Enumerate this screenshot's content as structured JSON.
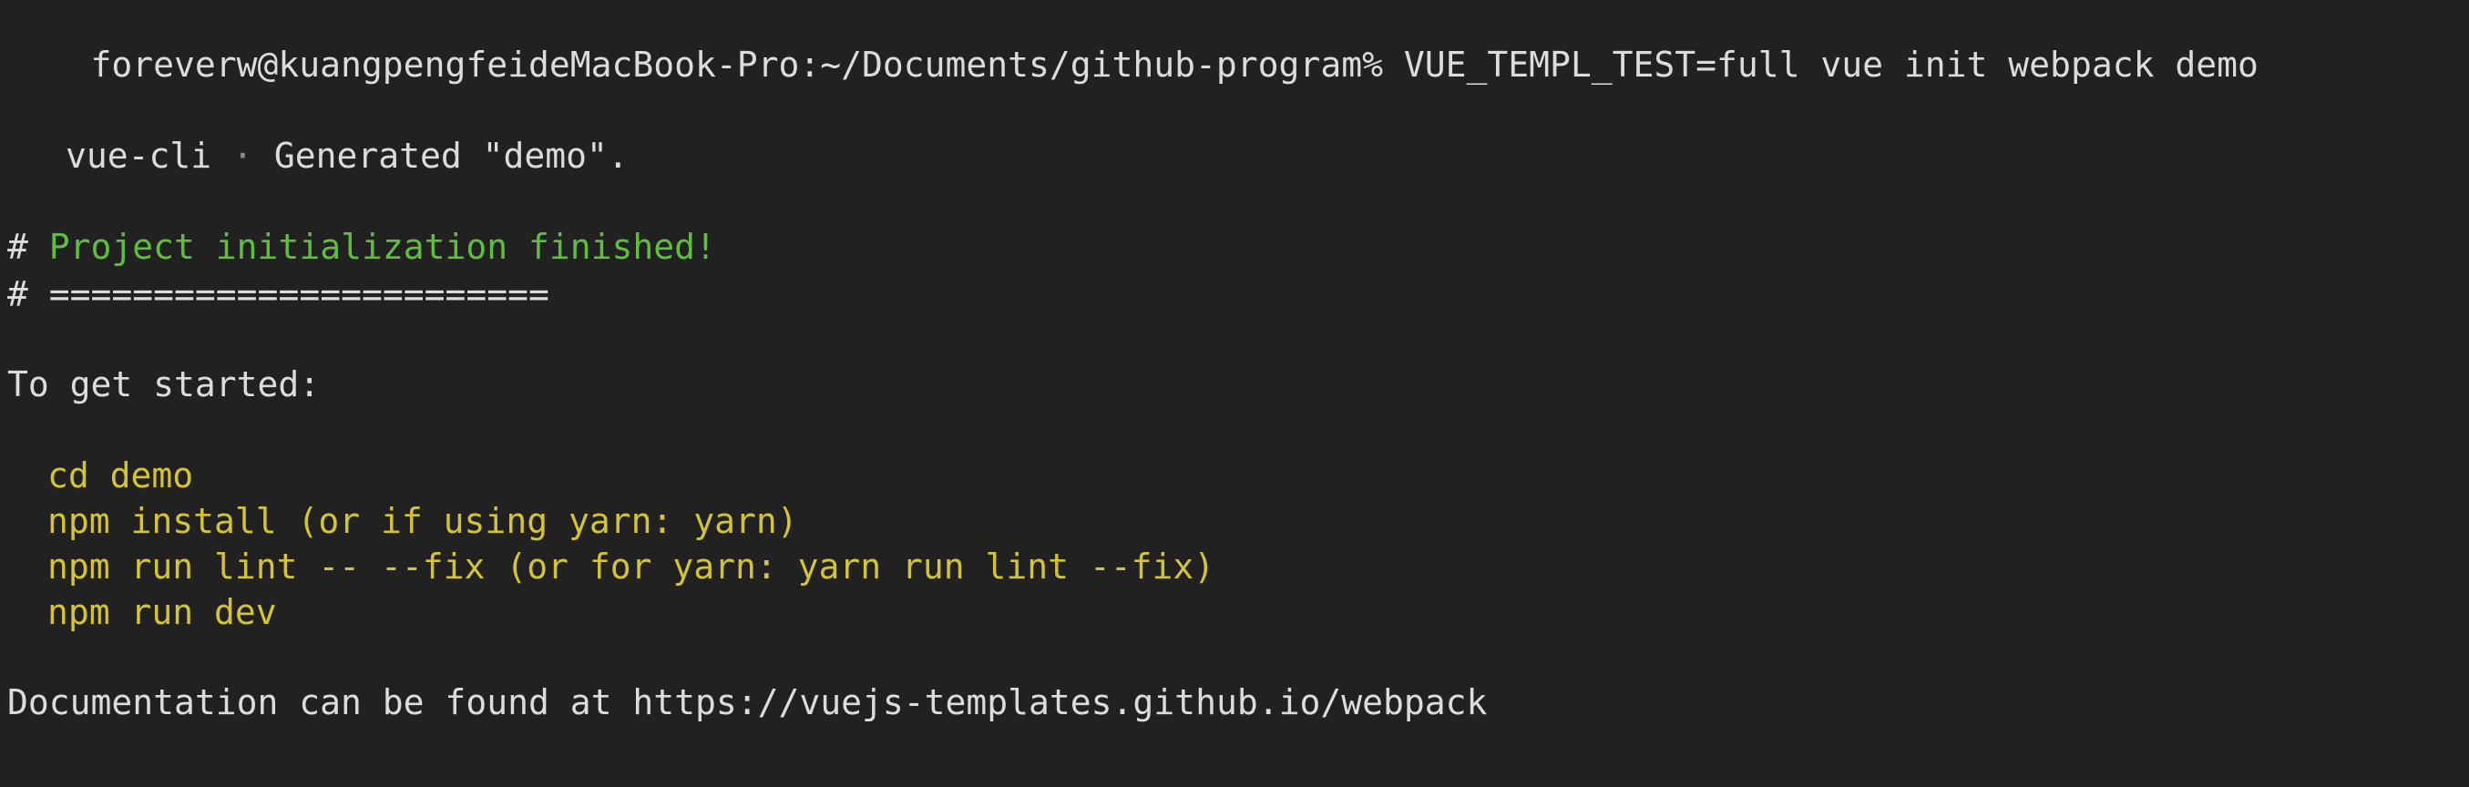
{
  "terminal": {
    "prompt": "foreverw@kuangpengfeideMacBook-Pro:~/Documents/github-program%",
    "command": "VUE_TEMPL_TEST=full vue init webpack demo",
    "generated": {
      "tool": "vue-cli",
      "separator": "·",
      "message": "Generated \"demo\"."
    },
    "hash1": "#",
    "finished": "Project initialization finished!",
    "hash2": "#",
    "rule": "========================",
    "get_started": "To get started:",
    "steps": [
      "cd demo",
      "npm install (or if using yarn: yarn)",
      "npm run lint -- --fix (or for yarn: yarn run lint --fix)",
      "npm run dev"
    ],
    "docs_prefix": "Documentation can be found at",
    "docs_url": "https://vuejs-templates.github.io/webpack"
  },
  "colors": {
    "background": "#212121",
    "text": "#dcdcdc",
    "green": "#5fbf3c",
    "yellow": "#d4c337"
  }
}
